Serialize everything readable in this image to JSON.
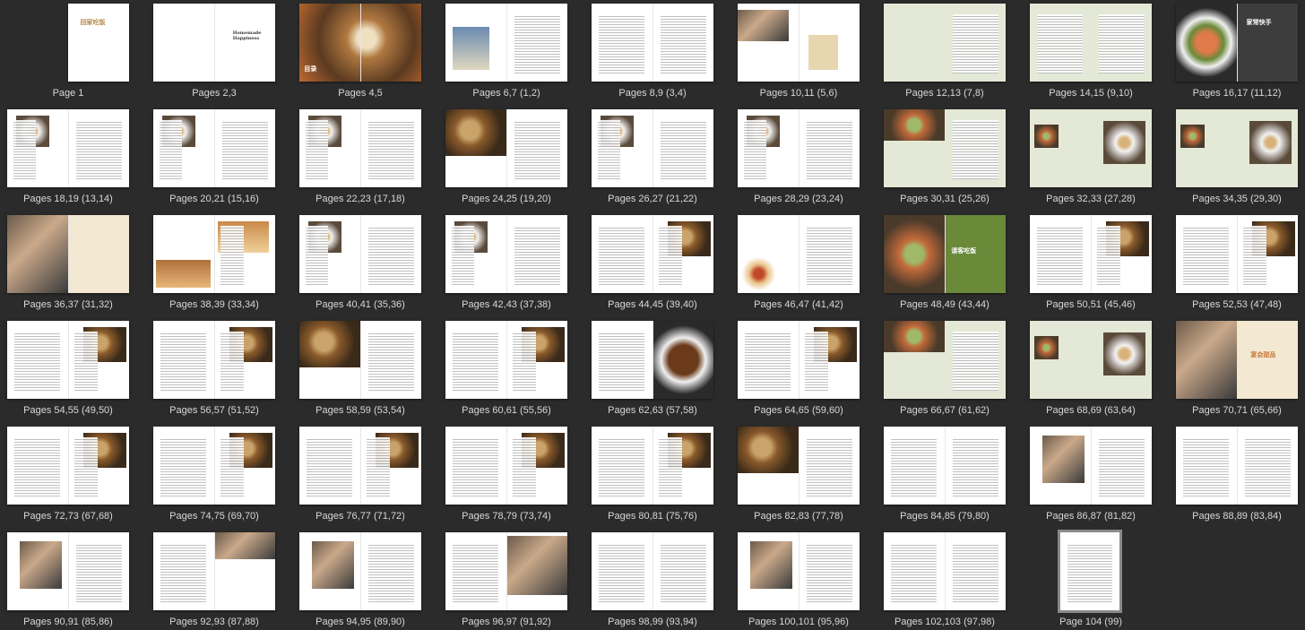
{
  "thumbnails": [
    {
      "label": "Page 1",
      "kind": "cover",
      "pages": 1
    },
    {
      "label": "Pages 2,3",
      "kind": "titlepage",
      "pages": 2
    },
    {
      "label": "Pages 4,5",
      "kind": "photo-full",
      "pages": 2
    },
    {
      "label": "Pages 6,7 (1,2)",
      "kind": "intro",
      "pages": 2
    },
    {
      "label": "Pages 8,9 (3,4)",
      "kind": "text",
      "pages": 2
    },
    {
      "label": "Pages 10,11 (5,6)",
      "kind": "photo-text",
      "pages": 2
    },
    {
      "label": "Pages 12,13 (7,8)",
      "kind": "green-text",
      "pages": 2
    },
    {
      "label": "Pages 14,15 (9,10)",
      "kind": "green-text2",
      "pages": 2
    },
    {
      "label": "Pages 16,17 (11,12)",
      "kind": "salmon",
      "pages": 2
    },
    {
      "label": "Pages 18,19 (13,14)",
      "kind": "recipe",
      "pages": 2
    },
    {
      "label": "Pages 20,21 (15,16)",
      "kind": "recipe",
      "pages": 2
    },
    {
      "label": "Pages 22,23 (17,18)",
      "kind": "recipe",
      "pages": 2
    },
    {
      "label": "Pages 24,25 (19,20)",
      "kind": "recipe-dark",
      "pages": 2
    },
    {
      "label": "Pages 26,27 (21,22)",
      "kind": "recipe",
      "pages": 2
    },
    {
      "label": "Pages 28,29 (23,24)",
      "kind": "recipe",
      "pages": 2
    },
    {
      "label": "Pages 30,31 (25,26)",
      "kind": "green-photo",
      "pages": 2
    },
    {
      "label": "Pages 32,33 (27,28)",
      "kind": "green-photo2",
      "pages": 2
    },
    {
      "label": "Pages 34,35 (29,30)",
      "kind": "green-photo2",
      "pages": 2
    },
    {
      "label": "Pages 36,37 (31,32)",
      "kind": "people-beige",
      "pages": 2
    },
    {
      "label": "Pages 38,39 (33,34)",
      "kind": "bread",
      "pages": 2
    },
    {
      "label": "Pages 40,41 (35,36)",
      "kind": "recipe",
      "pages": 2
    },
    {
      "label": "Pages 42,43 (37,38)",
      "kind": "recipe",
      "pages": 2
    },
    {
      "label": "Pages 44,45 (39,40)",
      "kind": "recipe2",
      "pages": 2
    },
    {
      "label": "Pages 46,47 (41,42)",
      "kind": "pizza",
      "pages": 2
    },
    {
      "label": "Pages 48,49 (43,44)",
      "kind": "food-green",
      "pages": 2
    },
    {
      "label": "Pages 50,51 (45,46)",
      "kind": "recipe2",
      "pages": 2
    },
    {
      "label": "Pages 52,53 (47,48)",
      "kind": "recipe2",
      "pages": 2
    },
    {
      "label": "Pages 54,55 (49,50)",
      "kind": "recipe2",
      "pages": 2
    },
    {
      "label": "Pages 56,57 (51,52)",
      "kind": "recipe2",
      "pages": 2
    },
    {
      "label": "Pages 58,59 (53,54)",
      "kind": "recipe-dark",
      "pages": 2
    },
    {
      "label": "Pages 60,61 (55,56)",
      "kind": "recipe2",
      "pages": 2
    },
    {
      "label": "Pages 62,63 (57,58)",
      "kind": "ribs",
      "pages": 2
    },
    {
      "label": "Pages 64,65 (59,60)",
      "kind": "recipe2",
      "pages": 2
    },
    {
      "label": "Pages 66,67 (61,62)",
      "kind": "green-photo",
      "pages": 2
    },
    {
      "label": "Pages 68,69 (63,64)",
      "kind": "green-photo2",
      "pages": 2
    },
    {
      "label": "Pages 70,71 (65,66)",
      "kind": "cake",
      "pages": 2
    },
    {
      "label": "Pages 72,73 (67,68)",
      "kind": "recipe2",
      "pages": 2
    },
    {
      "label": "Pages 74,75 (69,70)",
      "kind": "recipe2",
      "pages": 2
    },
    {
      "label": "Pages 76,77 (71,72)",
      "kind": "recipe2",
      "pages": 2
    },
    {
      "label": "Pages 78,79 (73,74)",
      "kind": "recipe2",
      "pages": 2
    },
    {
      "label": "Pages 80,81 (75,76)",
      "kind": "recipe2",
      "pages": 2
    },
    {
      "label": "Pages 82,83 (77,78)",
      "kind": "recipe-dark",
      "pages": 2
    },
    {
      "label": "Pages 84,85 (79,80)",
      "kind": "text",
      "pages": 2
    },
    {
      "label": "Pages 86,87 (81,82)",
      "kind": "people",
      "pages": 2
    },
    {
      "label": "Pages 88,89 (83,84)",
      "kind": "text",
      "pages": 2
    },
    {
      "label": "Pages 90,91 (85,86)",
      "kind": "people",
      "pages": 2
    },
    {
      "label": "Pages 92,93 (87,88)",
      "kind": "text-photo",
      "pages": 2
    },
    {
      "label": "Pages 94,95 (89,90)",
      "kind": "people",
      "pages": 2
    },
    {
      "label": "Pages 96,97 (91,92)",
      "kind": "group",
      "pages": 2
    },
    {
      "label": "Pages 98,99 (93,94)",
      "kind": "text",
      "pages": 2
    },
    {
      "label": "Pages 100,101 (95,96)",
      "kind": "people",
      "pages": 2
    },
    {
      "label": "Pages 102,103 (97,98)",
      "kind": "text",
      "pages": 2
    },
    {
      "label": "Page 104 (99)",
      "kind": "last",
      "pages": 1
    }
  ],
  "cover": {
    "title": "回家吃饭",
    "subtitle": "Homemade Happiness",
    "toc": "目录"
  },
  "section_titles": [
    "家常快手",
    "请客吃饭",
    "宴会甜品"
  ],
  "colors": {
    "background": "#2b2b2b",
    "caption": "#d8d8d8",
    "green_page": "#e4e8d6",
    "beige_page": "#f3e8d2",
    "accent_orange": "#c8783a",
    "accent_green": "#6a8a3a"
  },
  "selected_index": 52
}
